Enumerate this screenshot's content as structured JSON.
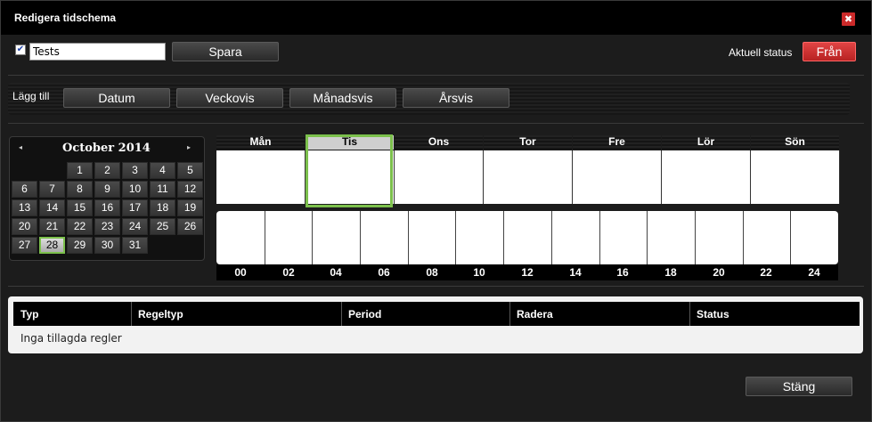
{
  "window": {
    "title": "Redigera tidschema",
    "close_symbol": "✖"
  },
  "form": {
    "enabled_check": "✔",
    "name_value": "Tests",
    "save_label": "Spara",
    "status_label": "Aktuell status",
    "status_value": "Från"
  },
  "add": {
    "label": "Lägg till",
    "buttons": [
      "Datum",
      "Veckovis",
      "Månadsvis",
      "Årsvis"
    ]
  },
  "calendar": {
    "month_year": "October 2014",
    "prev_symbol": "◂",
    "next_symbol": "▸",
    "selected_day": "28",
    "weeks": [
      [
        "",
        "",
        "1",
        "2",
        "3",
        "4",
        "5"
      ],
      [
        "6",
        "7",
        "8",
        "9",
        "10",
        "11",
        "12"
      ],
      [
        "13",
        "14",
        "15",
        "16",
        "17",
        "18",
        "19"
      ],
      [
        "20",
        "21",
        "22",
        "23",
        "24",
        "25",
        "26"
      ],
      [
        "27",
        "28",
        "29",
        "30",
        "31",
        "",
        ""
      ]
    ]
  },
  "week": {
    "days": [
      "Mån",
      "Tis",
      "Ons",
      "Tor",
      "Fre",
      "Lör",
      "Sön"
    ],
    "selected_index": 1
  },
  "hours": [
    "00",
    "02",
    "04",
    "06",
    "08",
    "10",
    "12",
    "14",
    "16",
    "18",
    "20",
    "22",
    "24"
  ],
  "rules": {
    "columns": [
      "Typ",
      "Regeltyp",
      "Period",
      "Radera",
      "Status"
    ],
    "empty_text": "Inga tillagda regler"
  },
  "footer": {
    "close_label": "Stäng"
  }
}
